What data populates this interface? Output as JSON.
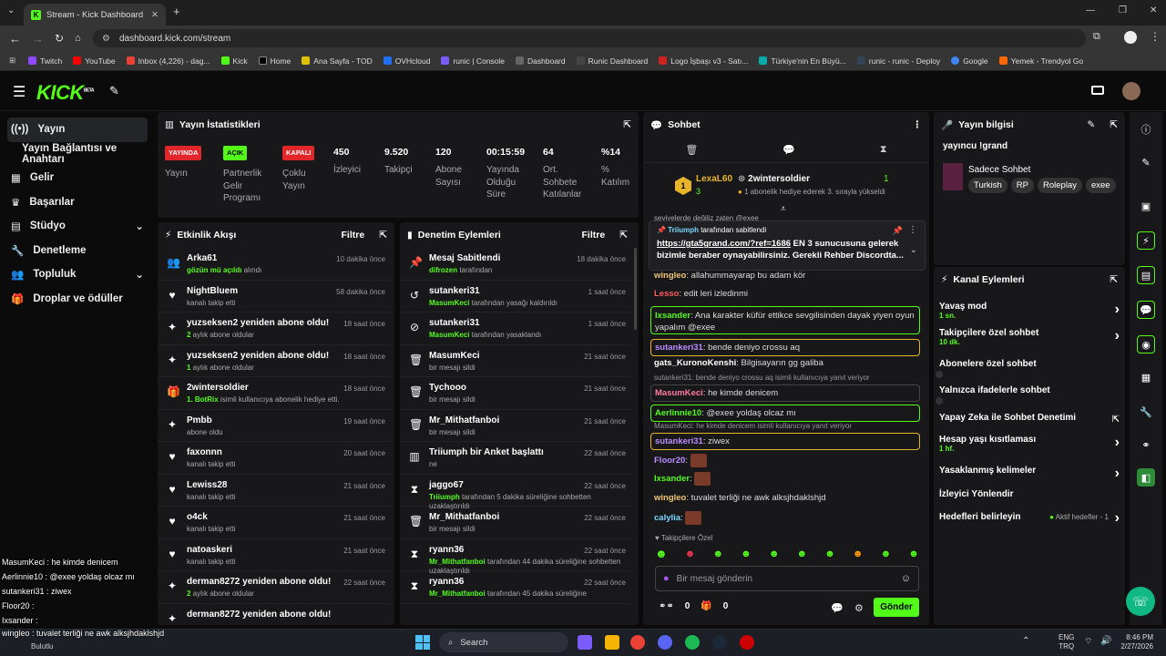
{
  "browser": {
    "tab_title": "Stream - Kick Dashboard",
    "url": "dashboard.kick.com/stream",
    "bookmarks": [
      "Twitch",
      "YouTube",
      "Inbox (4,226) - dag...",
      "Kick",
      "Home",
      "Ana Sayfa - TOD",
      "OVHcloud",
      "runic | Console",
      "Dashboard",
      "Runic Dashboard",
      "Logo İşbaşı v3 - Satı...",
      "Türkiye'nin En Büyü...",
      "runic - runic - Deploy",
      "Google",
      "Yemek - Trendyol Go"
    ]
  },
  "app": {
    "logo": "KICK",
    "logo_sup": "BETA"
  },
  "sidebar": {
    "items": [
      "Yayın",
      "Yayın Bağlantısı ve Anahtarı",
      "Gelir",
      "Başarılar",
      "Stüdyo",
      "Denetleme",
      "Topluluk",
      "Droplar ve ödüller"
    ]
  },
  "stats": {
    "title": "Yayın İstatistikleri",
    "status": [
      {
        "badge": "YAYINDA",
        "label": "Yayın"
      },
      {
        "badge": "AÇIK",
        "label": "Partnerlik Gelir Programı"
      },
      {
        "badge": "KAPALI",
        "label": "Çoklu Yayın"
      }
    ],
    "metrics": [
      {
        "value": "450",
        "label": "İzleyici"
      },
      {
        "value": "9.520",
        "label": "Takipçi"
      },
      {
        "value": "120",
        "label": "Abone Sayısı"
      },
      {
        "value": "00:15:59",
        "label": "Yayında Olduğu Süre"
      },
      {
        "value": "64",
        "label": "Ort. Sohbete Katılanlar"
      },
      {
        "value": "%14",
        "label": "% Katılım"
      }
    ]
  },
  "activity": {
    "title": "Etkinlik Akışı",
    "filter": "Filtre",
    "events": [
      {
        "title": "Arka61",
        "pre": "",
        "hl": "gözün mü açıldı",
        "post": " alındı",
        "time": "10 dakika önce"
      },
      {
        "title": "NightBluem",
        "pre": "kanalı takip etti",
        "hl": "",
        "post": "",
        "time": "58 dakika önce"
      },
      {
        "title": "yuzseksen2 yeniden abone oldu!",
        "pre": "",
        "hl": "2",
        "post": " aylık abone oldular",
        "time": "18 saat önce"
      },
      {
        "title": "yuzseksen2 yeniden abone oldu!",
        "pre": "",
        "hl": "1",
        "post": " aylık abone oldular",
        "time": "18 saat önce"
      },
      {
        "title": "2wintersoldier",
        "pre": "",
        "hl": "1. BotRix",
        "post": " isimli kullanıcıya abonelik hediye etti.",
        "time": "18 saat önce"
      },
      {
        "title": "Pmbb",
        "pre": "abone oldu",
        "hl": "",
        "post": "",
        "time": "19 saat önce"
      },
      {
        "title": "faxonnn",
        "pre": "kanalı takip etti",
        "hl": "",
        "post": "",
        "time": "20 saat önce"
      },
      {
        "title": "Lewiss28",
        "pre": "kanalı takip etti",
        "hl": "",
        "post": "",
        "time": "21 saat önce"
      },
      {
        "title": "o4ck",
        "pre": "kanalı takip etti",
        "hl": "",
        "post": "",
        "time": "21 saat önce"
      },
      {
        "title": "natoaskeri",
        "pre": "kanalı takip etti",
        "hl": "",
        "post": "",
        "time": "21 saat önce"
      },
      {
        "title": "derman8272 yeniden abone oldu!",
        "pre": "",
        "hl": "2",
        "post": " aylık abone oldular",
        "time": "22 saat önce"
      },
      {
        "title": "derman8272 yeniden abone oldu!",
        "pre": "",
        "hl": "",
        "post": "",
        "time": ""
      }
    ]
  },
  "moderation": {
    "title": "Denetim Eylemleri",
    "filter": "Filtre",
    "actions": [
      {
        "title": "Mesaj Sabitlendi",
        "hl": "difrozen",
        "post": " tarafından",
        "time": "18 dakika önce",
        "icon": "📌"
      },
      {
        "title": "sutankeri31",
        "hl": "MasumKeci",
        "post": " tarafından yasağı kaldırıldı",
        "time": "1 saat önce",
        "icon": "↺"
      },
      {
        "title": "sutankeri31",
        "hl": "MasumKeci",
        "post": " tarafından yasaklandı",
        "time": "1 saat önce",
        "icon": "⊘"
      },
      {
        "title": "MasumKeci",
        "hl": "",
        "post": "bir mesajı sildi",
        "time": "21 saat önce",
        "icon": "🗑"
      },
      {
        "title": "Tychooo",
        "hl": "",
        "post": "bir mesajı sildi",
        "time": "21 saat önce",
        "icon": "🗑"
      },
      {
        "title": "Mr_Mithatfanboi",
        "hl": "",
        "post": "bir mesajı sildi",
        "time": "21 saat önce",
        "icon": "🗑"
      },
      {
        "title": "Triiumph bir Anket başlattı",
        "hl": "",
        "post": "ne",
        "time": "22 saat önce",
        "icon": "▥"
      },
      {
        "title": "jaggo67",
        "hl": "Triiumph",
        "post": " tarafından 5 dakika süreliğine sohbetten uzaklaştırıldı",
        "time": "22 saat önce",
        "icon": "⧗"
      },
      {
        "title": "Mr_Mithatfanboi",
        "hl": "",
        "post": "bir mesajı sildi",
        "time": "22 saat önce",
        "icon": "🗑"
      },
      {
        "title": "ryann36",
        "hl": "Mr_Mithatfanboi",
        "post": " tarafından 44 dakika süreliğine sohbetten uzaklaştırıldı",
        "time": "22 saat önce",
        "icon": "⧗"
      },
      {
        "title": "ryann36",
        "hl": "Mr_Mithatfanboi",
        "post": " tarafından 45 dakika süreliğine",
        "time": "22 saat önce",
        "icon": "⧗"
      }
    ]
  },
  "chat": {
    "title": "Sohbet",
    "gifter": {
      "name": "LexaL60",
      "count": "3",
      "name2": "2wintersoldier",
      "count2": "1",
      "msg": "1 abonelik hediye ederek 3. sırayla yükseldi"
    },
    "pinned": {
      "by": "Triiumph",
      "by_suffix": " tarafından sabitlendi",
      "link": "https://gta5grand.com/?ref=1686",
      "text": " EN 3 sunucusuna gelerek bizimle beraber oynayabilirsiniz. Gerekli Rehber Discordta..."
    },
    "partial": "seviyelerde değiliz zaten @exee",
    "messages": [
      {
        "user": "wingleo",
        "color": "#f0c674",
        "text": "allahummayarap bu adam kör"
      },
      {
        "user": "Lesso",
        "color": "#ff5a5a",
        "text": "edit leri izledinmi"
      },
      {
        "user": "Ixsander",
        "color": "#53fc18",
        "text": "Ana karakter küfür ettikce sevgilisinden dayak yiyen oyun yapalım @exee"
      },
      {
        "user": "sutankeri31",
        "color": "#b98cff",
        "text": "bende deniyo crossu aq"
      },
      {
        "user": "gats_KuronoKenshi",
        "color": "#ffffff",
        "text": "Bilgisayarın gg galiba"
      },
      {
        "reply": "sutankeri31: bende deniyo crossu aq isimli kullanıcıya yanıt veriyor",
        "user": "MasumKeci",
        "color": "#ff7aa0",
        "text": "he kimde denicem"
      },
      {
        "user": "Aerlinnie10",
        "color": "#53fc18",
        "text": "@exee yoldaş olcaz mı"
      },
      {
        "reply": "MasumKeci: he kimde denicem isimli kullanıcıya yanıt veriyor",
        "user": "sutankeri31",
        "color": "#b98cff",
        "text": "ziwex"
      },
      {
        "user": "Floor20",
        "color": "#b98cff",
        "text": ""
      },
      {
        "user": "Ixsander",
        "color": "#53fc18",
        "text": ""
      },
      {
        "user": "wingleo",
        "color": "#f0c674",
        "text": "tuvalet terliği ne awk alksjhdaklshjd"
      },
      {
        "user": "calylia",
        "color": "#7ad7ff",
        "text": ""
      }
    ],
    "followers_label": "Takipçilere Özel",
    "input_placeholder": "Bir mesaj gönderin",
    "send": "Gönder",
    "count1": "0"
  },
  "info": {
    "title": "Yayın bilgisi",
    "streamer": "yayıncu !grand",
    "category": "Sadece Sohbet",
    "tags": [
      "Turkish",
      "RP",
      "Roleplay",
      "exee"
    ]
  },
  "channel_actions": {
    "title": "Kanal Eylemleri",
    "items": [
      {
        "label": "Yavaş mod",
        "sub": "1 sn.",
        "ctrl": "chev"
      },
      {
        "label": "Takipçilere özel sohbet",
        "sub": "10 dk.",
        "ctrl": "chev"
      },
      {
        "label": "Abonelere özel sohbet",
        "sub": "",
        "ctrl": "toggle"
      },
      {
        "label": "Yalnızca ifadelerle sohbet",
        "sub": "",
        "ctrl": "toggle"
      },
      {
        "label": "Yapay Zeka ile Sohbet Denetimi",
        "sub": "",
        "ctrl": "ext"
      },
      {
        "label": "Hesap yaşı kısıtlaması",
        "sub": "1 hf.",
        "ctrl": "chev"
      },
      {
        "label": "Yasaklanmış kelimeler",
        "sub": "",
        "ctrl": "chev"
      },
      {
        "label": "İzleyici Yönlendir",
        "sub": "",
        "ctrl": ""
      },
      {
        "label": "Hedefleri belirleyin",
        "sub": "",
        "ctrl": "goal"
      }
    ],
    "goals_label": "Aktif hedefler - 1"
  },
  "overlay": [
    "MasumKeci : he kimde denicem",
    "Aerlinnie10 : @exee yoldaş olcaz mı",
    "sutankeri31 : ziwex",
    "Floor20 :",
    "Ixsander :",
    "wingleo : tuvalet terliği ne awk alksjhdaklshjd"
  ],
  "taskbar": {
    "weather": "Bulutlu",
    "search": "Search",
    "lang1": "ENG",
    "lang2": "TRQ",
    "time": "8:46 PM",
    "date": "2/27/2026"
  }
}
